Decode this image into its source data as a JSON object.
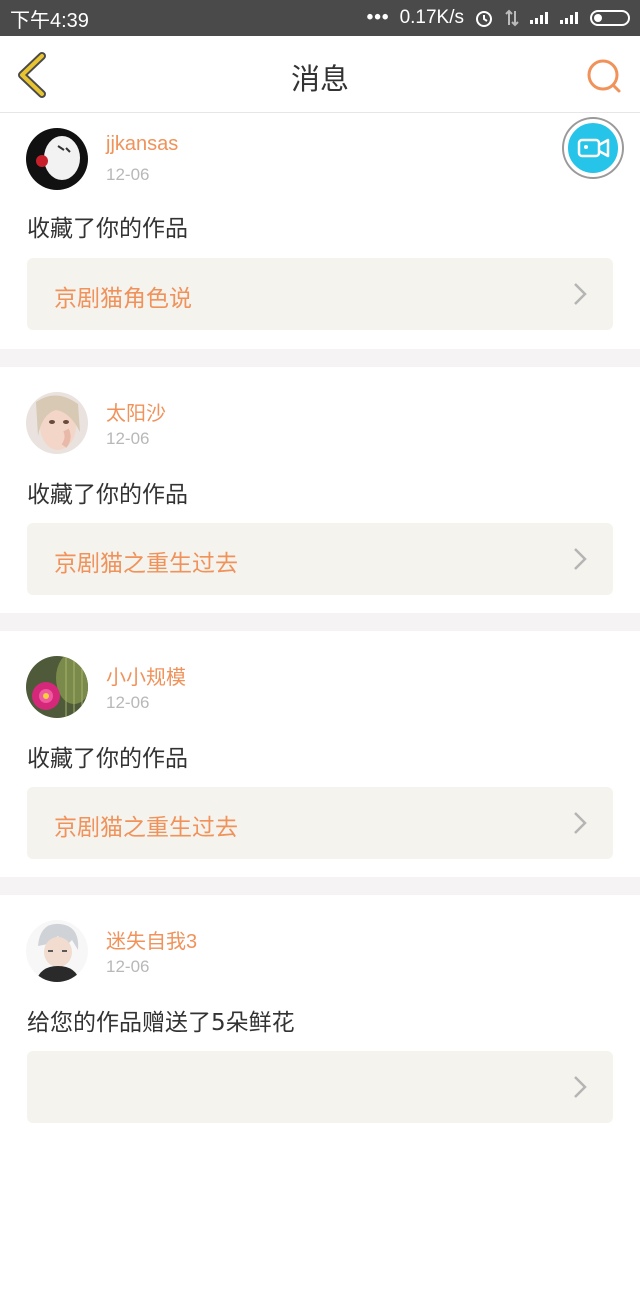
{
  "status_bar": {
    "time": "下午4:39",
    "dots": "•••",
    "speed": "0.17K/s"
  },
  "nav": {
    "title": "消息"
  },
  "messages": [
    {
      "username": "jjkansas",
      "date": "12-06",
      "action": "收藏了你的作品",
      "work_title": "京剧猫角色说"
    },
    {
      "username": "太阳沙",
      "date": "12-06",
      "action": "收藏了你的作品",
      "work_title": "京剧猫之重生过去"
    },
    {
      "username": "小小规模",
      "date": "12-06",
      "action": "收藏了你的作品",
      "work_title": "京剧猫之重生过去"
    },
    {
      "username": "迷失自我3",
      "date": "12-06",
      "action": "给您的作品赠送了5朵鲜花",
      "work_title": ""
    }
  ],
  "colors": {
    "accent": "#f0925a",
    "back_icon": "#e8c430",
    "video_button": "#26c4e8"
  }
}
